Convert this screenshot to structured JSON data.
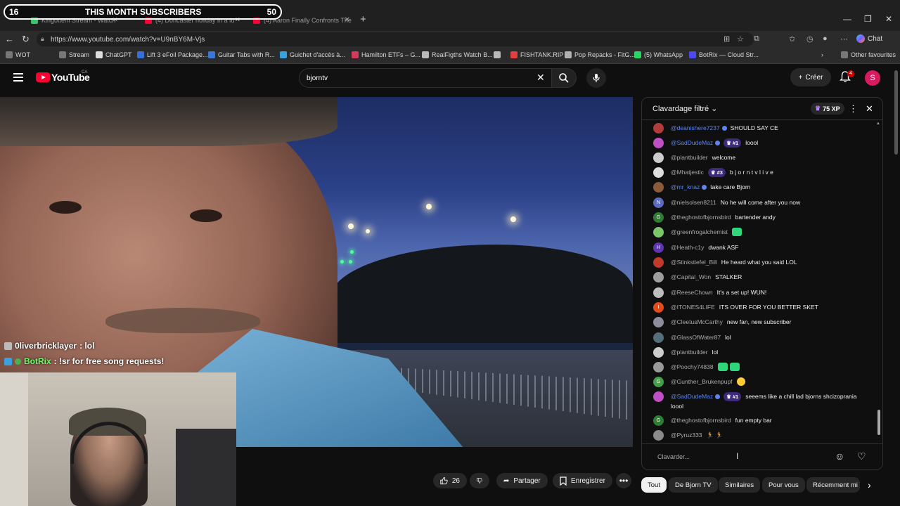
{
  "overlay": {
    "left": "16",
    "title": "THIS MONTH SUBSCRIBERS",
    "right": "50"
  },
  "browser": {
    "tabs": [
      {
        "title": "Kingottem Stream - Watch",
        "color": "#39c46b"
      },
      {
        "title": "(4) Doncaster holiday in a fu",
        "color": "#ff0033"
      },
      {
        "title": "(4) Aaron Finally Confronts The Ic",
        "color": "#ff0033"
      }
    ],
    "url": "https://www.youtube.com/watch?v=U9nBY6M-Vjs",
    "chat_label": "Chat",
    "bookmarks": [
      {
        "label": "WOT",
        "icon": "folder-icon",
        "color": "#777777"
      },
      {
        "label": "Stream",
        "icon": "folder-icon",
        "color": "#777777"
      },
      {
        "label": "ChatGPT",
        "icon": "chatgpt-icon",
        "color": "#dddddd"
      },
      {
        "label": "Lift 3 eFoil Package...",
        "icon": "lift-icon",
        "color": "#3b6fd8"
      },
      {
        "label": "Guitar Tabs with R...",
        "icon": "tabs-icon",
        "color": "#3a78d8"
      },
      {
        "label": "Guichet d'accès à...",
        "icon": "guichet-icon",
        "color": "#3aa0e0"
      },
      {
        "label": "Hamilton ETFs – G...",
        "icon": "hamilton-icon",
        "color": "#d23c5a"
      },
      {
        "label": "RealFigths Watch B...",
        "icon": "wordpress-icon",
        "color": "#bbbbbb"
      },
      {
        "label": "",
        "icon": "globe-icon",
        "color": "#bbbbbb"
      },
      {
        "label": "FISHTANK.RIP",
        "icon": "fishtank-icon",
        "color": "#e04040"
      },
      {
        "label": "Pop Repacks - FitG...",
        "icon": "fitgirl-icon",
        "color": "#b0b0b0"
      },
      {
        "label": "(5) WhatsApp",
        "icon": "whatsapp-icon",
        "color": "#2bd366"
      },
      {
        "label": "BotRix — Cloud Str...",
        "icon": "botrix-icon",
        "color": "#4a4af0"
      }
    ],
    "other_favourites": "Other favourites"
  },
  "youtube": {
    "logo_text": "YouTube",
    "country": "CA",
    "search_value": "bjorntv",
    "create_label": "Créer",
    "notif_count": "4",
    "avatar_letter": "S"
  },
  "stream_overlay_chat": [
    {
      "user": "0liverbricklayer",
      "text": " : lol"
    },
    {
      "user": "BotRix",
      "text": " : !sr for free song requests!"
    }
  ],
  "actions": {
    "likes": "26",
    "share_label": "Partager",
    "save_label": "Enregistrer"
  },
  "chat": {
    "title": "Clavardage filtré",
    "xp": "75 XP",
    "input_placeholder": "Clavarder...",
    "messages": [
      {
        "user": "@deanishere7237",
        "verified": true,
        "rank": "",
        "text": "SHOULD SAY CE",
        "avatar_color": "#b23b3b",
        "avatar_letter": ""
      },
      {
        "user": "@SadDudeMaz",
        "verified": true,
        "rank": "#1",
        "text": "loool",
        "avatar_color": "#c04fc4",
        "avatar_letter": ""
      },
      {
        "user": "@plantbuilder",
        "verified": false,
        "rank": "",
        "text": "welcome",
        "avatar_color": "#cccccc",
        "avatar_letter": ""
      },
      {
        "user": "@Mhatjestic",
        "verified": false,
        "rank": "#3",
        "text": "b j o r n t v l i v e",
        "avatar_color": "#dddddd",
        "avatar_letter": ""
      },
      {
        "user": "@mr_knaz",
        "verified": true,
        "rank": "",
        "text": "take care Bjorn",
        "avatar_color": "#8a5a3a",
        "avatar_letter": ""
      },
      {
        "user": "@nielsolsen8211",
        "verified": false,
        "rank": "",
        "text": "No he will come after you now",
        "avatar_color": "#5c6bc0",
        "avatar_letter": "N"
      },
      {
        "user": "@theghostofbjornsbird",
        "verified": false,
        "rank": "",
        "text": "bartender andy",
        "avatar_color": "#2e7d32",
        "avatar_letter": "G"
      },
      {
        "user": "@greenfrogalchemist",
        "verified": false,
        "rank": "",
        "text": "",
        "emotes": 1,
        "avatar_color": "#7cc56b",
        "avatar_letter": ""
      },
      {
        "user": "@Heath-c1y",
        "verified": false,
        "rank": "",
        "text": "dwank ASF",
        "avatar_color": "#5e35b1",
        "avatar_letter": "H"
      },
      {
        "user": "@Stinkstiefel_Bill",
        "verified": false,
        "rank": "",
        "text": "He heard what you said LOL",
        "avatar_color": "#c0392b",
        "avatar_letter": ""
      },
      {
        "user": "@Capital_Won",
        "verified": false,
        "rank": "",
        "text": "STALKER",
        "avatar_color": "#9e9e9e",
        "avatar_letter": ""
      },
      {
        "user": "@ReeseChown",
        "verified": false,
        "rank": "",
        "text": "It's a set up! WUN!",
        "avatar_color": "#bdbdbd",
        "avatar_letter": ""
      },
      {
        "user": "@ITONES4LIFE",
        "verified": false,
        "rank": "",
        "text": "ITS OVER FOR YOU BETTER SKET",
        "avatar_color": "#e64a19",
        "avatar_letter": "I"
      },
      {
        "user": "@CleetusMcCarthy",
        "verified": false,
        "rank": "",
        "text": "new fan, new subscriber",
        "avatar_color": "#8d8d9d",
        "avatar_letter": ""
      },
      {
        "user": "@GlassOfWater87",
        "verified": false,
        "rank": "",
        "text": "lol",
        "avatar_color": "#546e7a",
        "avatar_letter": ""
      },
      {
        "user": "@plantbuilder",
        "verified": false,
        "rank": "",
        "text": "lol",
        "avatar_color": "#cccccc",
        "avatar_letter": ""
      },
      {
        "user": "@Poochy74838",
        "verified": false,
        "rank": "",
        "text": "",
        "emotes": 2,
        "avatar_color": "#9a9a9a",
        "avatar_letter": ""
      },
      {
        "user": "@Gunther_Brukenpupf",
        "verified": false,
        "rank": "",
        "text": "",
        "smile": true,
        "avatar_color": "#43a047",
        "avatar_letter": "G"
      },
      {
        "user": "@SadDudeMaz",
        "verified": true,
        "rank": "#1",
        "text": "seeems like a chill lad bjorns shcizoprania",
        "text2": "loool",
        "avatar_color": "#c04fc4",
        "avatar_letter": ""
      },
      {
        "user": "@theghostofbjornsbird",
        "verified": false,
        "rank": "",
        "text": "fun empty bar",
        "avatar_color": "#2e7d32",
        "avatar_letter": "G"
      },
      {
        "user": "@Pyruz333",
        "verified": false,
        "rank": "",
        "text": "🏃 🏃",
        "avatar_color": "#8a8a8a",
        "avatar_letter": ""
      }
    ]
  },
  "chips": [
    "Tout",
    "De Bjorn TV",
    "Similaires",
    "Pour vous",
    "Récemment mi"
  ]
}
